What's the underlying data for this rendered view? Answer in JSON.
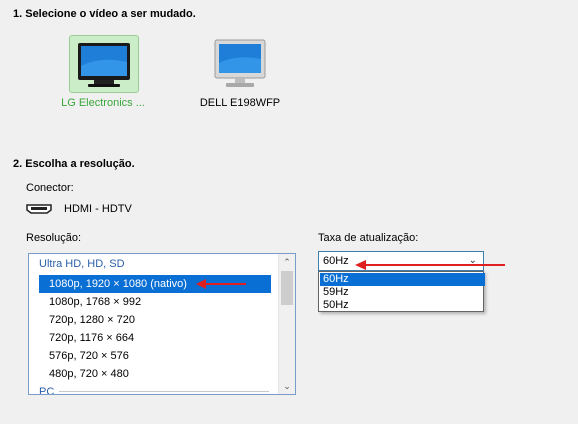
{
  "section1": {
    "title": "1. Selecione o vídeo a ser mudado."
  },
  "monitors": [
    {
      "label": "LG Electronics ...",
      "selected": true
    },
    {
      "label": "DELL E198WFP",
      "selected": false
    }
  ],
  "section2": {
    "title": "2. Escolha a resolução.",
    "connector_label": "Conector:",
    "connector_value": "HDMI - HDTV",
    "resolution_label": "Resolução:",
    "refresh_label": "Taxa de atualização:"
  },
  "resolution_list": {
    "group_header": "Ultra HD, HD, SD",
    "items": [
      {
        "label": "1080p, 1920 × 1080 (nativo)",
        "selected": true
      },
      {
        "label": "1080p, 1768 × 992",
        "selected": false
      },
      {
        "label": "720p, 1280 × 720",
        "selected": false
      },
      {
        "label": "720p, 1176 × 664",
        "selected": false
      },
      {
        "label": "576p, 720 × 576",
        "selected": false
      },
      {
        "label": "480p, 720 × 480",
        "selected": false
      }
    ],
    "next_group_partial": "PC"
  },
  "refresh_select": {
    "value": "60Hz",
    "options": [
      "60Hz",
      "59Hz",
      "50Hz"
    ],
    "highlighted": "60Hz"
  },
  "colors": {
    "selected_label_green": "#3aa63a",
    "selection_blue": "#0a6fd4",
    "group_header_blue": "#2a5ea8",
    "annotation_arrow_red": "#e02020"
  }
}
